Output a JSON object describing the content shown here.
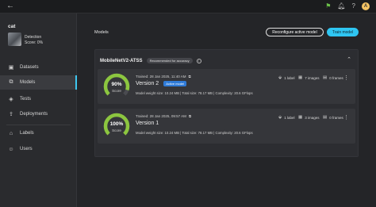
{
  "topbar": {
    "back_icon": "back-arrow-icon",
    "avatar_letter": "A",
    "accent": "#6cc24a"
  },
  "project": {
    "name": "cat",
    "task": "Detection",
    "score": "Score: 0%"
  },
  "sidebar": {
    "items": [
      {
        "label": "Datasets",
        "icon": "datasets-icon"
      },
      {
        "label": "Models",
        "icon": "models-icon",
        "active": true
      },
      {
        "label": "Tests",
        "icon": "tests-icon"
      },
      {
        "label": "Deployments",
        "icon": "deployments-icon"
      },
      {
        "label": "Labels",
        "icon": "labels-icon"
      },
      {
        "label": "Users",
        "icon": "users-icon"
      }
    ]
  },
  "main": {
    "title": "Models",
    "reconfigure_label": "Reconfigure active model",
    "train_label": "Train model",
    "accent": "#2fc6f2"
  },
  "group": {
    "name": "MobileNetV2-ATSS",
    "badge": "Recommended for accuracy",
    "info": "i"
  },
  "versions": [
    {
      "score": "90%",
      "score_value": 0.9,
      "score_label": "Score",
      "trained": "Trained: 28 Jan 2025, 11:40 AM",
      "version": "Version 2",
      "active_badge": "Active model",
      "meta": "Model weight size: 10.24 MB | Total size: 78.17 MB | Complexity: 20.6 GFlops",
      "labels": "1 label",
      "images": "7 images",
      "frames": "0 frames"
    },
    {
      "score": "100%",
      "score_value": 1.0,
      "score_label": "Score",
      "trained": "Trained: 28 Jan 2025, 09:57 AM",
      "version": "Version 1",
      "active_badge": "",
      "meta": "Model weight size: 10.24 MB | Total size: 78.17 MB | Complexity: 20.6 GFlops",
      "labels": "1 label",
      "images": "3 images",
      "frames": "0 frames"
    }
  ],
  "colors": {
    "gauge_fill": "#8cc63f",
    "gauge_track": "#4a4b50"
  }
}
